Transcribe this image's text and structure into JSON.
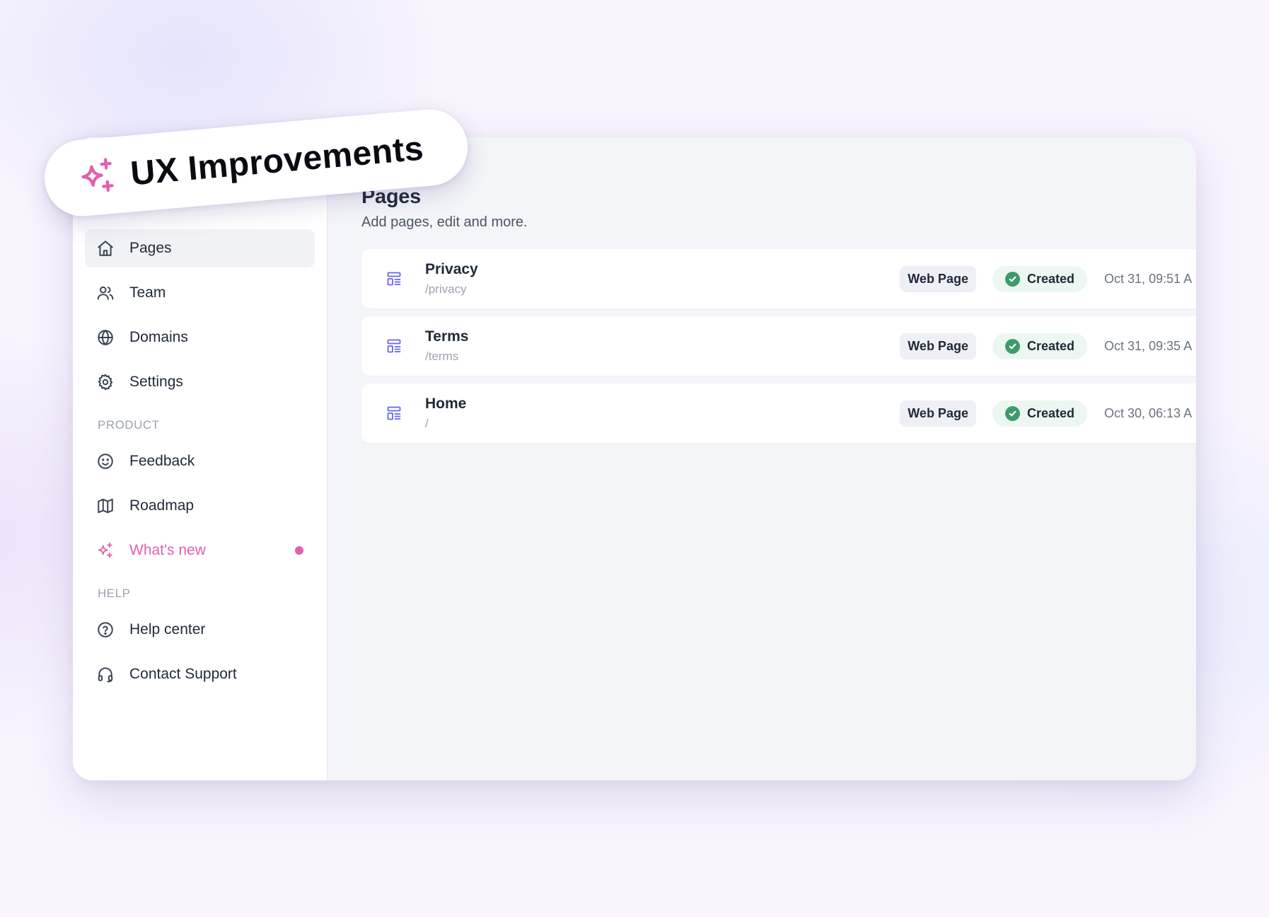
{
  "promo": {
    "label": "UX Improvements",
    "icon": "sparkles-icon",
    "accent_color": "#e45fad"
  },
  "sidebar": {
    "items": [
      {
        "label": "Pages",
        "icon": "home-icon",
        "active": true
      },
      {
        "label": "Team",
        "icon": "users-icon"
      },
      {
        "label": "Domains",
        "icon": "globe-icon"
      },
      {
        "label": "Settings",
        "icon": "gear-icon"
      }
    ],
    "sections": [
      {
        "label": "PRODUCT",
        "items": [
          {
            "label": "Feedback",
            "icon": "smiley-icon"
          },
          {
            "label": "Roadmap",
            "icon": "map-icon"
          },
          {
            "label": "What's new",
            "icon": "sparkles-icon",
            "highlight": true,
            "has_dot": true
          }
        ]
      },
      {
        "label": "HELP",
        "items": [
          {
            "label": "Help center",
            "icon": "question-circle-icon"
          },
          {
            "label": "Contact Support",
            "icon": "headset-icon"
          }
        ]
      }
    ]
  },
  "main": {
    "title": "Pages",
    "subtitle": "Add pages, edit and more.",
    "rows": [
      {
        "title": "Privacy",
        "path": "/privacy",
        "type": "Web Page",
        "status": "Created",
        "date": "Oct 31, 09:51 A"
      },
      {
        "title": "Terms",
        "path": "/terms",
        "type": "Web Page",
        "status": "Created",
        "date": "Oct 31, 09:35 A"
      },
      {
        "title": "Home",
        "path": "/",
        "type": "Web Page",
        "status": "Created",
        "date": "Oct 30, 06:13 A"
      }
    ],
    "row_icon": "page-layout-icon",
    "status_color": "#3f9a6b"
  }
}
